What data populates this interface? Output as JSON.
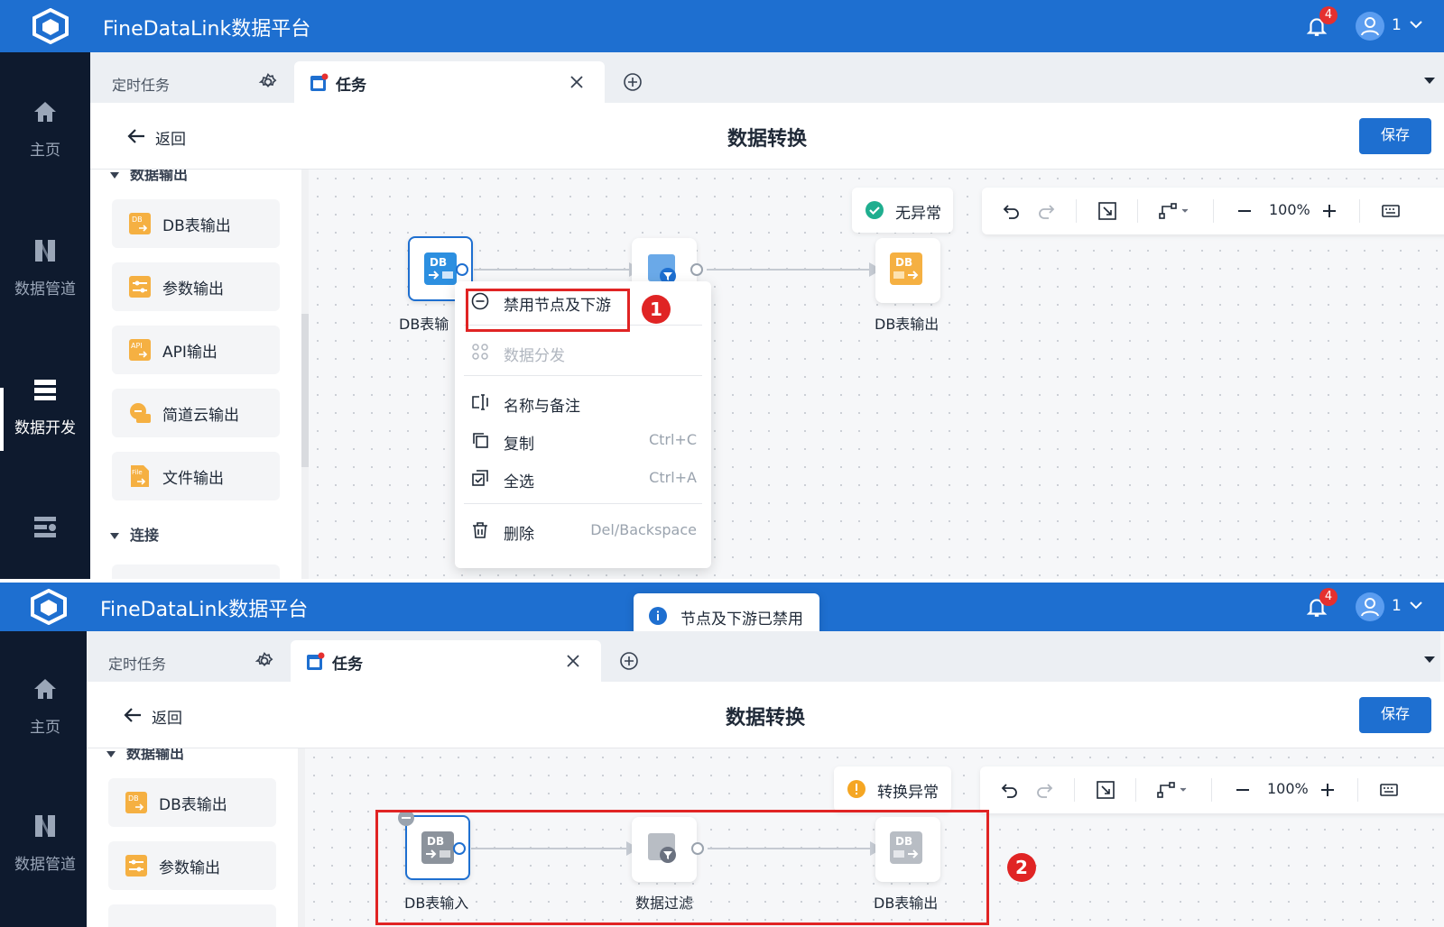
{
  "app": {
    "title": "FineDataLink数据平台",
    "notification_count": "4",
    "user": "1"
  },
  "sidebar": {
    "items": [
      {
        "label": "主页",
        "icon": "home-icon"
      },
      {
        "label": "数据管道",
        "icon": "pipeline-icon"
      },
      {
        "label": "数据开发",
        "icon": "dev-icon"
      },
      {
        "label": "",
        "icon": "service-icon"
      }
    ]
  },
  "tabs": {
    "scheduled": "定时任务",
    "task": "任务"
  },
  "header": {
    "back": "返回",
    "title": "数据转换",
    "save": "保存"
  },
  "left_panel": {
    "section_output": "数据输出",
    "items": [
      "DB表输出",
      "参数输出",
      "API输出",
      "简道云输出",
      "文件输出"
    ],
    "section_connect": "连接"
  },
  "canvas_top": {
    "status": "无异常",
    "zoom": "100%",
    "nodes": {
      "input_partial": "DB表输",
      "output": "DB表输出"
    },
    "context_menu": {
      "disable": "禁用节点及下游",
      "distribute": "数据分发",
      "name_note": "名称与备注",
      "copy": "复制",
      "copy_shortcut": "Ctrl+C",
      "select_all": "全选",
      "select_all_shortcut": "Ctrl+A",
      "delete": "删除",
      "delete_shortcut": "Del/Backspace"
    },
    "step": "1"
  },
  "canvas_bottom": {
    "toast": "节点及下游已禁用",
    "status": "转换异常",
    "zoom": "100%",
    "nodes": {
      "input": "DB表输入",
      "filter": "数据过滤",
      "output": "DB表输出"
    },
    "step": "2"
  },
  "colors": {
    "brand": "#1e6fd0",
    "sidebar": "#0e1a2e",
    "danger": "#e02424",
    "success": "#1fae8f",
    "warning": "#f5a623"
  }
}
